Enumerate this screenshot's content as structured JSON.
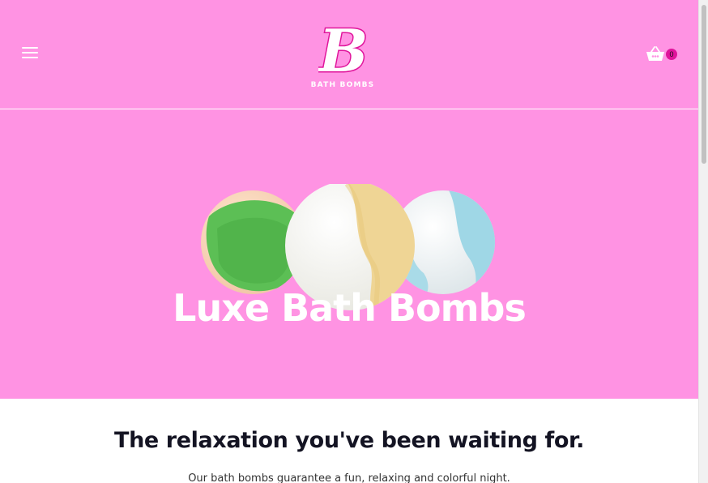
{
  "header": {
    "menu_icon": "hamburger-menu-icon",
    "logo_letter": "B",
    "logo_text": "BATH BOMBS",
    "cart_icon": "basket-icon",
    "cart_count": "0"
  },
  "hero": {
    "title": "Luxe Bath Bombs",
    "image_subject": "three bath bombs: green, white-yellow, white-blue"
  },
  "intro": {
    "heading": "The relaxation you've been waiting for.",
    "text": "Our bath bombs guarantee a fun, relaxing and colorful night."
  },
  "colors": {
    "brand_pink": "#ff93e3",
    "logo_magenta": "#e0149b",
    "white": "#ffffff",
    "heading_dark": "#141423"
  }
}
